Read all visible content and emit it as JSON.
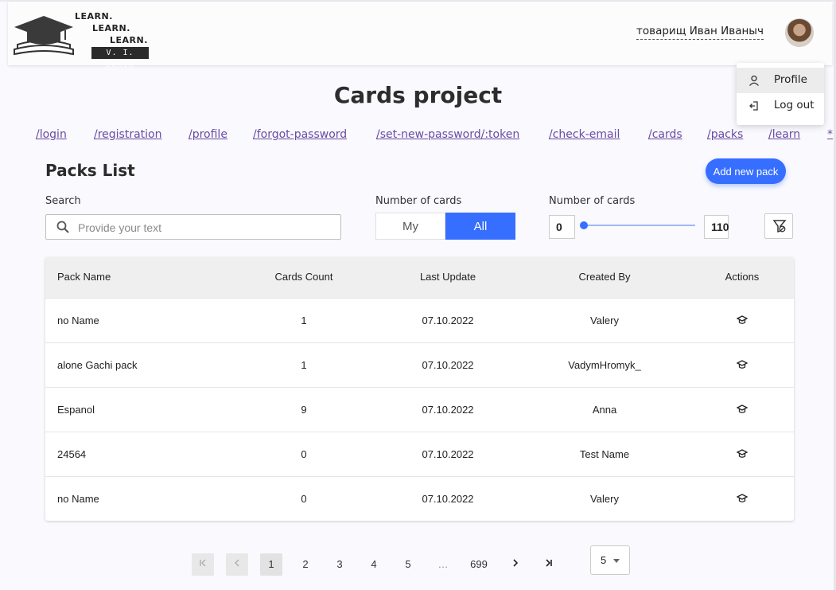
{
  "header": {
    "logo": {
      "line1": "LEARN.",
      "line2": "LEARN.",
      "line3": "LEARN.",
      "badge": "V. I. Lenin"
    },
    "user_name": "товарищ Иван Иваныч",
    "user_menu": [
      {
        "label": "Profile",
        "icon": "person-icon"
      },
      {
        "label": "Log out",
        "icon": "logout-icon"
      }
    ]
  },
  "title": "Cards project",
  "nav_links": [
    "/login",
    "/registration",
    "/profile",
    "/forgot-password",
    "/set-new-password/:token",
    "/check-email",
    "/cards",
    "/packs",
    "/learn",
    "*"
  ],
  "packs": {
    "title": "Packs List",
    "add_button": "Add new pack",
    "search": {
      "label": "Search",
      "placeholder": "Provide your text"
    },
    "owner_filter": {
      "label": "Number of cards",
      "options": [
        "My",
        "All"
      ],
      "selected": "All"
    },
    "range_filter": {
      "label": "Number of cards",
      "min": "0",
      "max": "110"
    },
    "columns": [
      "Pack Name",
      "Cards Count",
      "Last Update",
      "Created By",
      "Actions"
    ],
    "rows": [
      {
        "name": "no Name",
        "count": "1",
        "updated": "07.10.2022",
        "author": "Valery"
      },
      {
        "name": "alone Gachi pack",
        "count": "1",
        "updated": "07.10.2022",
        "author": "VadymHromyk_"
      },
      {
        "name": "Espanol",
        "count": "9",
        "updated": "07.10.2022",
        "author": "Anna"
      },
      {
        "name": "24564",
        "count": "0",
        "updated": "07.10.2022",
        "author": "Test Name"
      },
      {
        "name": "no Name",
        "count": "0",
        "updated": "07.10.2022",
        "author": "Valery"
      }
    ]
  },
  "pagination": {
    "pages": [
      "1",
      "2",
      "3",
      "4",
      "5",
      "…",
      "699"
    ],
    "current": "1",
    "first": "|<",
    "prev": "<",
    "next": ">",
    "last": ">|",
    "per_page": "5"
  },
  "colors": {
    "accent": "#366eff",
    "link": "#6a4aa3"
  }
}
